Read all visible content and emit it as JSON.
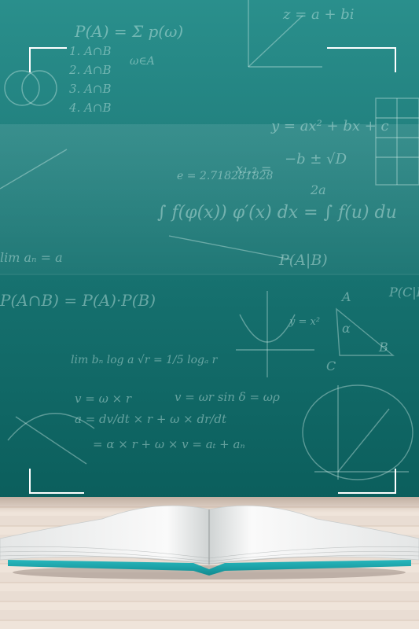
{
  "scene": {
    "formulas": [
      "P(A) = Σ p(ω)",
      "ω∈A",
      "z = a + bi",
      "1. A∩B",
      "2. A∩B",
      "3. A∩B",
      "4. A∩B",
      "y = ax² + bx + c",
      "−b ± √D",
      "x₁,₂ =",
      "2a",
      "e = 2.718281828",
      "∫ f(φ(x)) φ′(x) dx = ∫ f(u) du",
      "lim aₙ = a",
      "P(A|B)",
      "P(A∩B) = P(A)·P(B)",
      "y = x²",
      "lim bₙ log a √r = 1/5 logₐ r",
      "v = ω × r",
      "v = ωr sin δ = ωρ",
      "a = dv/dt × r + ω × dr/dt",
      "= α × r + ω × v = aₜ + aₙ",
      "P(C|B)",
      "A",
      "B",
      "C",
      "α"
    ],
    "colors": {
      "board": "#1a7a78",
      "chalk": "#dcf5f0",
      "floor": "#e9ddd3",
      "book_cover": "#1aa3a8",
      "frame": "#ffffff"
    }
  }
}
